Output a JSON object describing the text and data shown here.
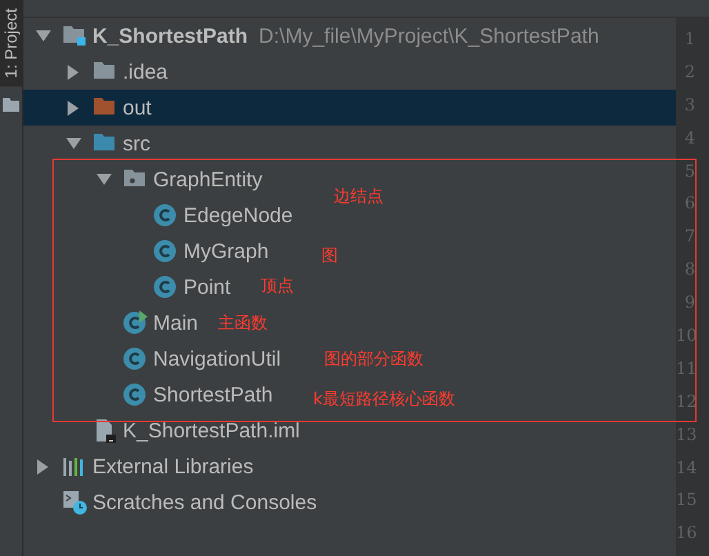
{
  "sidebar_tab": {
    "label": "1: Project",
    "selected": true
  },
  "tree": [
    {
      "label": "K_ShortestPath",
      "path": "D:\\My_file\\MyProject\\K_ShortestPath",
      "kind": "module",
      "expanded": true,
      "selected": false,
      "children": [
        {
          "label": ".idea",
          "kind": "folder",
          "expanded": false,
          "selected": false
        },
        {
          "label": "out",
          "kind": "excluded",
          "expanded": false,
          "selected": true
        },
        {
          "label": "src",
          "kind": "source",
          "expanded": true,
          "selected": false,
          "children": [
            {
              "label": "GraphEntity",
              "kind": "package",
              "expanded": true,
              "selected": false,
              "children": [
                {
                  "label": "EdegeNode",
                  "kind": "class",
                  "selected": false
                },
                {
                  "label": "MyGraph",
                  "kind": "class",
                  "selected": false
                },
                {
                  "label": "Point",
                  "kind": "class",
                  "selected": false
                }
              ]
            },
            {
              "label": "Main",
              "kind": "main",
              "selected": false
            },
            {
              "label": "NavigationUtil",
              "kind": "class",
              "selected": false
            },
            {
              "label": "ShortestPath",
              "kind": "class",
              "selected": false
            }
          ]
        },
        {
          "label": "K_ShortestPath.iml",
          "kind": "iml",
          "selected": false
        }
      ]
    },
    {
      "label": "External Libraries",
      "kind": "libraries",
      "expanded": false,
      "selected": false
    },
    {
      "label": "Scratches and Consoles",
      "kind": "scratches",
      "selected": false
    }
  ],
  "gutter": {
    "line_numbers": [
      "1",
      "2",
      "3",
      "4",
      "5",
      "6",
      "7",
      "8",
      "9",
      "10",
      "11",
      "12",
      "13",
      "14",
      "15",
      "16"
    ]
  },
  "annotations": [
    {
      "text": "边结点"
    },
    {
      "text": "图"
    },
    {
      "text": "顶点"
    },
    {
      "text": "主函数"
    },
    {
      "text": "图的部分函数"
    },
    {
      "text": "k最短路径核心函数"
    }
  ]
}
